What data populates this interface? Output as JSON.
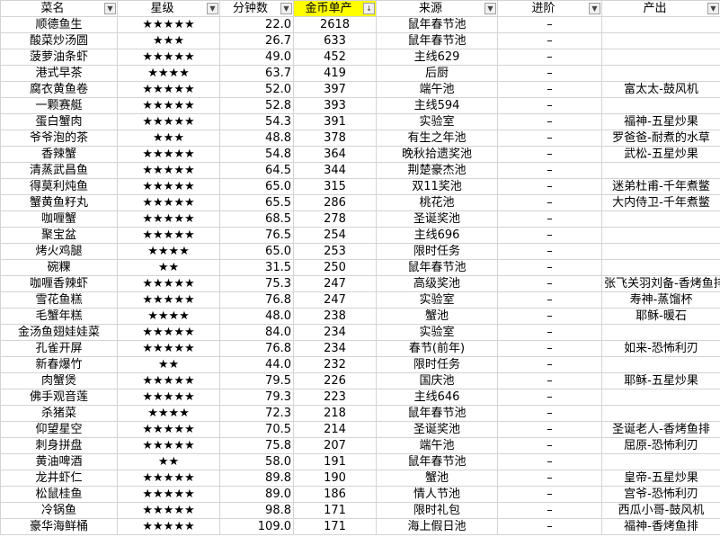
{
  "headers": [
    {
      "label": "菜名",
      "filter": "▼"
    },
    {
      "label": "星级",
      "filter": "▼"
    },
    {
      "label": "分钟数",
      "filter": "▼"
    },
    {
      "label": "金币单产",
      "filter": "↓",
      "highlight": "#ffff00"
    },
    {
      "label": "来源",
      "filter": "▼"
    },
    {
      "label": "进阶",
      "filter": "▼"
    },
    {
      "label": "产出",
      "filter": "▼"
    }
  ],
  "rows": [
    {
      "name": "顺德鱼生",
      "stars": "★★★★★",
      "minutes": "22.0",
      "gold": "2618",
      "source": "鼠年春节池",
      "advance": "–",
      "output": ""
    },
    {
      "name": "酸菜炒汤圆",
      "stars": "★★★",
      "minutes": "26.7",
      "gold": "633",
      "source": "鼠年春节池",
      "advance": "–",
      "output": ""
    },
    {
      "name": "菠萝油条虾",
      "stars": "★★★★★",
      "minutes": "49.0",
      "gold": "452",
      "source": "主线629",
      "advance": "–",
      "output": ""
    },
    {
      "name": "港式早茶",
      "stars": "★★★★",
      "minutes": "63.7",
      "gold": "419",
      "source": "后厨",
      "advance": "–",
      "output": ""
    },
    {
      "name": "腐衣黄鱼卷",
      "stars": "★★★★★",
      "minutes": "52.0",
      "gold": "397",
      "source": "端午池",
      "advance": "–",
      "output": "富太太-鼓风机"
    },
    {
      "name": "一颗赛艇",
      "stars": "★★★★★",
      "minutes": "52.8",
      "gold": "393",
      "source": "主线594",
      "advance": "–",
      "output": ""
    },
    {
      "name": "蛋白蟹肉",
      "stars": "★★★★★",
      "minutes": "54.3",
      "gold": "391",
      "source": "实验室",
      "advance": "–",
      "output": "福神-五星炒果"
    },
    {
      "name": "爷爷泡的茶",
      "stars": "★★★",
      "minutes": "48.8",
      "gold": "378",
      "source": "有生之年池",
      "advance": "–",
      "output": "罗爸爸-耐煮的水草"
    },
    {
      "name": "香辣蟹",
      "stars": "★★★★★",
      "minutes": "54.8",
      "gold": "364",
      "source": "晚秋拾遗奖池",
      "advance": "–",
      "output": "武松-五星炒果"
    },
    {
      "name": "清蒸武昌鱼",
      "stars": "★★★★★",
      "minutes": "64.5",
      "gold": "344",
      "source": "荆楚豪杰池",
      "advance": "–",
      "output": ""
    },
    {
      "name": "得莫利炖鱼",
      "stars": "★★★★★",
      "minutes": "65.0",
      "gold": "315",
      "source": "双11奖池",
      "advance": "–",
      "output": "迷弟杜甫-千年煮鳖"
    },
    {
      "name": "蟹黄鱼籽丸",
      "stars": "★★★★★",
      "minutes": "65.5",
      "gold": "286",
      "source": "桃花池",
      "advance": "–",
      "output": "大内侍卫-千年煮鳖"
    },
    {
      "name": "咖喱蟹",
      "stars": "★★★★★",
      "minutes": "68.5",
      "gold": "278",
      "source": "圣诞奖池",
      "advance": "–",
      "output": ""
    },
    {
      "name": "聚宝盆",
      "stars": "★★★★★",
      "minutes": "76.5",
      "gold": "254",
      "source": "主线696",
      "advance": "–",
      "output": ""
    },
    {
      "name": "烤火鸡腿",
      "stars": "★★★★",
      "minutes": "65.0",
      "gold": "253",
      "source": "限时任务",
      "advance": "–",
      "output": ""
    },
    {
      "name": "碗粿",
      "stars": "★★",
      "minutes": "31.5",
      "gold": "250",
      "source": "鼠年春节池",
      "advance": "–",
      "output": ""
    },
    {
      "name": "咖喱香辣虾",
      "stars": "★★★★★",
      "minutes": "75.3",
      "gold": "247",
      "source": "高级奖池",
      "advance": "–",
      "output": "张飞关羽刘备-香烤鱼排"
    },
    {
      "name": "雪花鱼糕",
      "stars": "★★★★★",
      "minutes": "76.8",
      "gold": "247",
      "source": "实验室",
      "advance": "–",
      "output": "寿神-蒸馏杯"
    },
    {
      "name": "毛蟹年糕",
      "stars": "★★★★",
      "minutes": "48.0",
      "gold": "238",
      "source": "蟹池",
      "advance": "–",
      "output": "耶稣-暖石"
    },
    {
      "name": "金汤鱼翅娃娃菜",
      "stars": "★★★★★",
      "minutes": "84.0",
      "gold": "234",
      "source": "实验室",
      "advance": "–",
      "output": ""
    },
    {
      "name": "孔雀开屏",
      "stars": "★★★★★",
      "minutes": "76.8",
      "gold": "234",
      "source": "春节(前年)",
      "advance": "–",
      "output": "如来-恐怖利刃"
    },
    {
      "name": "新春爆竹",
      "stars": "★★",
      "minutes": "44.0",
      "gold": "232",
      "source": "限时任务",
      "advance": "–",
      "output": ""
    },
    {
      "name": "肉蟹煲",
      "stars": "★★★★★",
      "minutes": "79.5",
      "gold": "226",
      "source": "国庆池",
      "advance": "–",
      "output": "耶稣-五星炒果"
    },
    {
      "name": "佛手观音莲",
      "stars": "★★★★★",
      "minutes": "79.3",
      "gold": "223",
      "source": "主线646",
      "advance": "–",
      "output": ""
    },
    {
      "name": "杀猪菜",
      "stars": "★★★★",
      "minutes": "72.3",
      "gold": "218",
      "source": "鼠年春节池",
      "advance": "–",
      "output": ""
    },
    {
      "name": "仰望星空",
      "stars": "★★★★★",
      "minutes": "70.5",
      "gold": "214",
      "source": "圣诞奖池",
      "advance": "–",
      "output": "圣诞老人-香烤鱼排"
    },
    {
      "name": "刺身拼盘",
      "stars": "★★★★★",
      "minutes": "75.8",
      "gold": "207",
      "source": "端午池",
      "advance": "–",
      "output": "屈原-恐怖利刃"
    },
    {
      "name": "黄油啤酒",
      "stars": "★★",
      "minutes": "58.0",
      "gold": "191",
      "source": "鼠年春节池",
      "advance": "–",
      "output": ""
    },
    {
      "name": "龙井虾仁",
      "stars": "★★★★★",
      "minutes": "89.8",
      "gold": "190",
      "source": "蟹池",
      "advance": "–",
      "output": "皇帝-五星炒果"
    },
    {
      "name": "松鼠桂鱼",
      "stars": "★★★★★",
      "minutes": "89.0",
      "gold": "186",
      "source": "情人节池",
      "advance": "–",
      "output": "宫爷-恐怖利刃"
    },
    {
      "name": "冷锅鱼",
      "stars": "★★★★★",
      "minutes": "98.8",
      "gold": "171",
      "source": "限时礼包",
      "advance": "–",
      "output": "西瓜小哥-鼓风机"
    },
    {
      "name": "豪华海鲜桶",
      "stars": "★★★★★",
      "minutes": "109.0",
      "gold": "171",
      "source": "海上假日池",
      "advance": "–",
      "output": "福神-香烤鱼排"
    }
  ]
}
